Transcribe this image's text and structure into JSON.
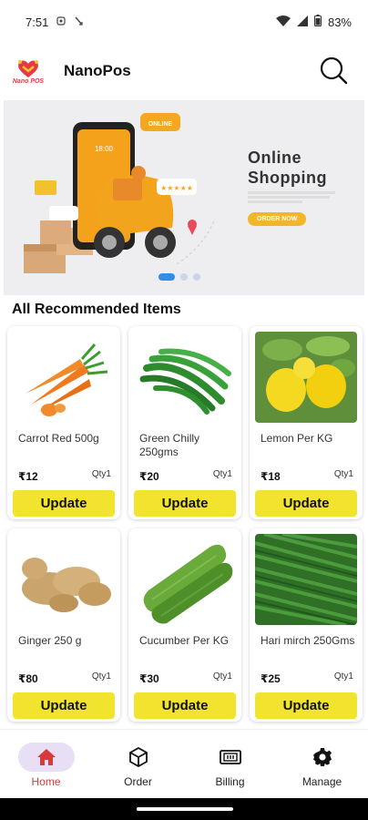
{
  "status_bar": {
    "time": "7:51",
    "battery": "83%"
  },
  "app_bar": {
    "title": "NanoPos",
    "logo_text": "Nano POS"
  },
  "banner": {
    "title": "Online Shopping",
    "bubble": "ONLINE",
    "phone_time": "18:00",
    "cta": "ORDER NOW",
    "slide_count": 3,
    "active_slide": 1
  },
  "section": {
    "title": "All Recommended Items"
  },
  "products": [
    {
      "name": "Carrot Red 500g",
      "price": "₹12",
      "qty": "Qty1",
      "button": "Update",
      "image": "carrot"
    },
    {
      "name": "Green Chilly 250gms",
      "price": "₹20",
      "qty": "Qty1",
      "button": "Update",
      "image": "green-chilli"
    },
    {
      "name": "Lemon Per KG",
      "price": "₹18",
      "qty": "Qty1",
      "button": "Update",
      "image": "lemon"
    },
    {
      "name": "Ginger 250 g",
      "price": "₹80",
      "qty": "Qty1",
      "button": "Update",
      "image": "ginger"
    },
    {
      "name": "Cucumber Per KG",
      "price": "₹30",
      "qty": "Qty1",
      "button": "Update",
      "image": "cucumber"
    },
    {
      "name": "Hari mirch 250Gms",
      "price": "₹25",
      "qty": "Qty1",
      "button": "Update",
      "image": "hari-mirch"
    }
  ],
  "bottom_nav": [
    {
      "label": "Home",
      "icon": "home-icon",
      "active": true
    },
    {
      "label": "Order",
      "icon": "cube-icon",
      "active": false
    },
    {
      "label": "Billing",
      "icon": "billing-icon",
      "active": false
    },
    {
      "label": "Manage",
      "icon": "gear-icon",
      "active": false
    }
  ],
  "colors": {
    "accent": "#f2e42e",
    "active_nav": "#d63a3a",
    "nav_pill": "#e8dff7"
  }
}
